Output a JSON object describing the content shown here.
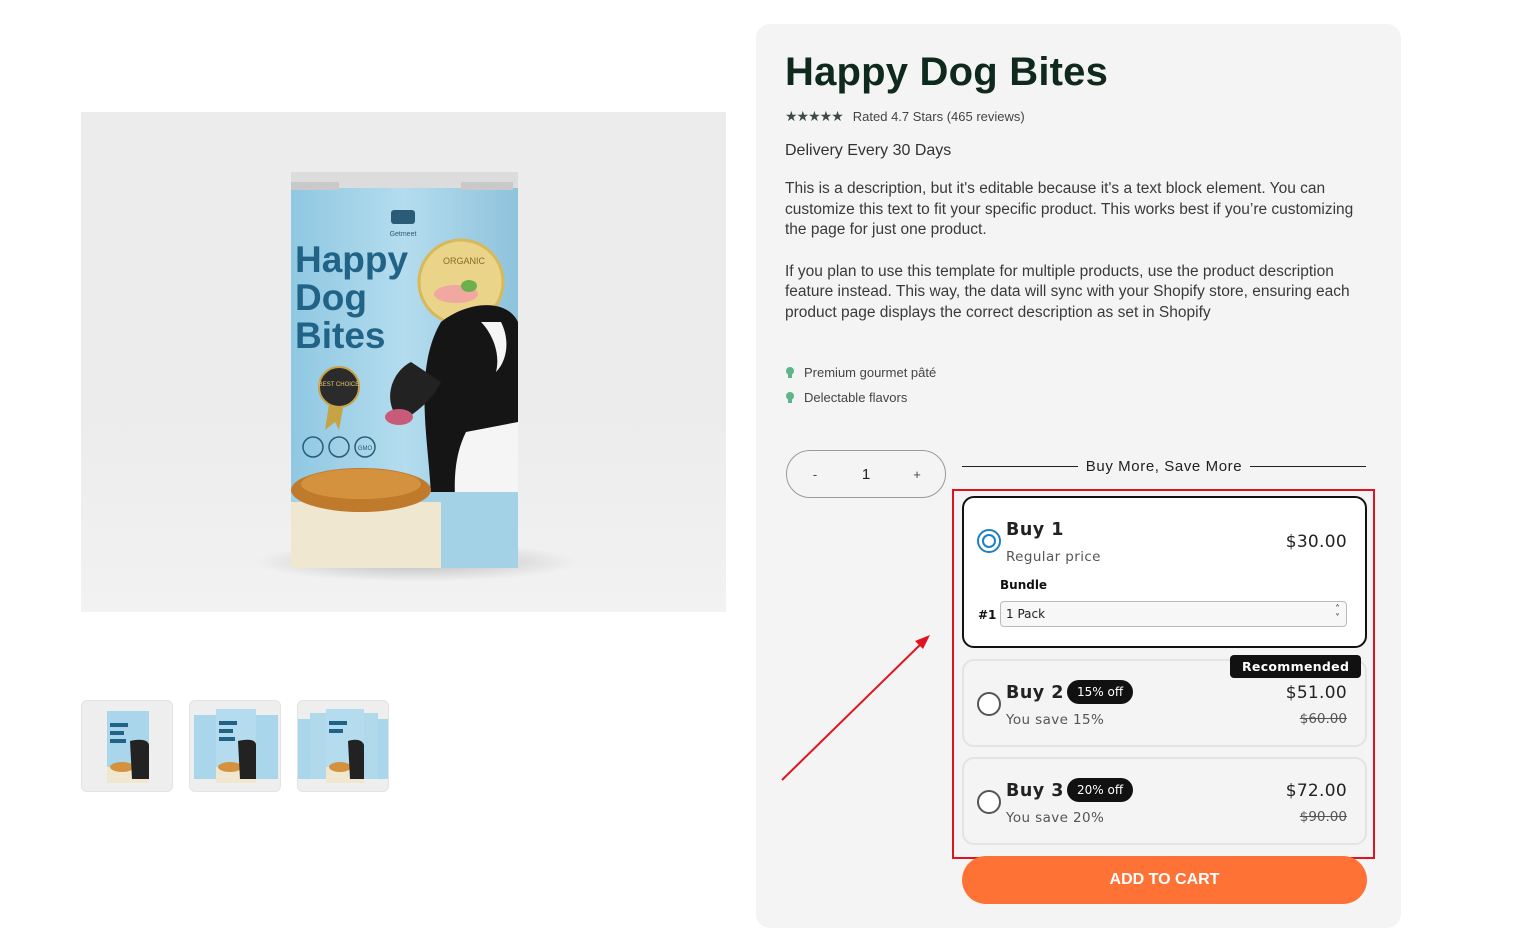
{
  "product": {
    "title": "Happy Dog Bites",
    "rating_stars": "★★★★★",
    "rating_text": "Rated 4.7 Stars (465 reviews)",
    "delivery": "Delivery Every 30 Days",
    "description": [
      "This is a description, but it's editable because it's a text block element. You can customize this text to fit your specific product. This works best if you’re customizing the page for just one product.",
      "If you plan to use this template for multiple products, use the product description feature instead. This way, the data will sync with your Shopify store, ensuring each product page displays the correct description as set in Shopify"
    ],
    "bullets": [
      "Premium gourmet pâté",
      "Delectable flavors"
    ]
  },
  "bag": {
    "brand": "Getmeet",
    "line1": "Happy",
    "line2": "Dog",
    "line3": "Bites",
    "seal_text": "ORGANIC",
    "badge_text": "BEST CHOICE",
    "gmo_text": "GMO"
  },
  "thumbnails": [
    {
      "name": "thumb-1-pack",
      "label": "1 pack"
    },
    {
      "name": "thumb-3-pack",
      "label": "3 packs"
    },
    {
      "name": "thumb-5-pack",
      "label": "5 packs"
    }
  ],
  "quantity": {
    "minus": "-",
    "value": "1",
    "plus": "+"
  },
  "buy_more": {
    "heading": "Buy More, Save More"
  },
  "offers": [
    {
      "title": "Buy 1",
      "subtitle": "Regular price",
      "price": "$30.00",
      "selected": true,
      "bundle_label": "Bundle",
      "bundle_index": "#1",
      "bundle_value": "1 Pack"
    },
    {
      "title": "Buy 2",
      "badge": "15% off",
      "subtitle": "You save 15%",
      "price": "$51.00",
      "compare": "$60.00",
      "tag": "Recommended"
    },
    {
      "title": "Buy 3",
      "badge": "20% off",
      "subtitle": "You save 20%",
      "price": "$72.00",
      "compare": "$90.00"
    }
  ],
  "cta": {
    "add_to_cart": "ADD TO CART"
  },
  "colors": {
    "accent": "#ff7236",
    "highlight_box": "#e0141f",
    "title": "#0f2a1d",
    "bag_blue": "#a9d6ea",
    "radio_selected": "#1f7fc4"
  }
}
